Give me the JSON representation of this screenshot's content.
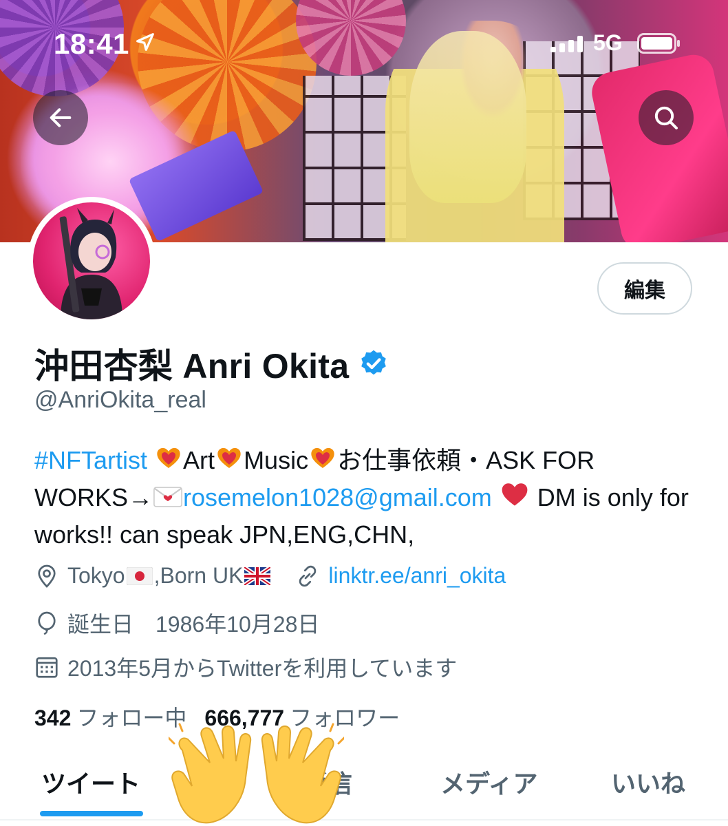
{
  "status_bar": {
    "time": "18:41",
    "network": "5G"
  },
  "header": {
    "back_icon": "arrow-left-icon",
    "search_icon": "search-icon"
  },
  "profile": {
    "edit_label": "編集",
    "display_name": "沖田杏梨 Anri Okita",
    "handle": "@AnriOkita_real",
    "bio": {
      "hashtag": "#NFTartist",
      "part1": "Art",
      "part2": "Music",
      "part3": "お仕事依頼・ASK FOR WORKS→",
      "email": "rosemelon1028@gmail.com",
      "part4": " DM is only for works!! can speak JPN,ENG,CHN,"
    },
    "location_a": "Tokyo",
    "location_b": ",Born UK",
    "website": "linktr.ee/anri_okita",
    "birthday": "誕生日　1986年10月28日",
    "joined": "2013年5月からTwitterを利用しています",
    "following_count": "342",
    "following_label": "フォロー中",
    "followers_count": "666,777",
    "followers_label": "フォロワー"
  },
  "tabs": [
    {
      "label": "ツイート",
      "active": true
    },
    {
      "label": "返信",
      "active": false
    },
    {
      "label": "メディア",
      "active": false
    },
    {
      "label": "いいね",
      "active": false
    }
  ],
  "colors": {
    "accent": "#1d9bf0",
    "secondary_text": "#536471",
    "primary_text": "#0f1419"
  }
}
